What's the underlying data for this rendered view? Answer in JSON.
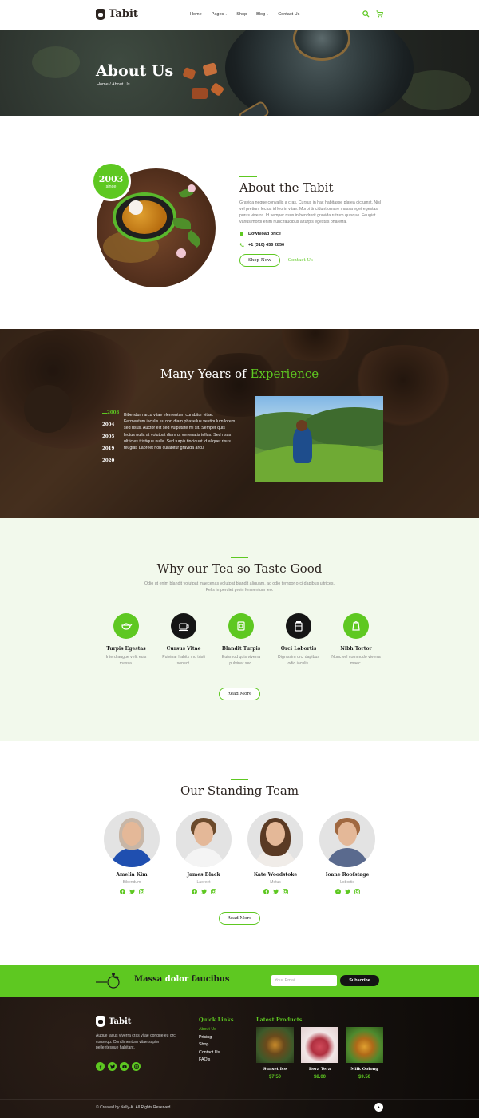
{
  "header": {
    "brand": "Tabit",
    "nav": [
      {
        "label": "Home",
        "has_dropdown": false
      },
      {
        "label": "Pages",
        "has_dropdown": true
      },
      {
        "label": "Shop",
        "has_dropdown": false
      },
      {
        "label": "Blog",
        "has_dropdown": true
      },
      {
        "label": "Contact Us",
        "has_dropdown": false
      }
    ],
    "cart_count": "0"
  },
  "hero": {
    "title": "About Us",
    "breadcrumb": "Home / About Us"
  },
  "about": {
    "badge_year": "2003",
    "badge_since": "since",
    "title": "About the Tabit",
    "text": "Gravida neque convallis a cras. Cursus in hac habitasse platea dictumst. Nisl vel pretium lectus id leo in vitae. Morbi tincidunt ornare massa eget egestas purus viverra. Id semper risus in hendrerit gravida rutrum quisque. Feugiat varius morbi enim nunc faucibus a turpis egestas pharetra.",
    "download_label": "Download price",
    "phone": "+1 (310) 456 2856",
    "shop_button": "Shop Now",
    "contact_link": "Contact Us"
  },
  "experience": {
    "title_prefix": "Many Years of ",
    "title_highlight": "Experience",
    "years": [
      "2003",
      "2004",
      "2005",
      "2019",
      "2020"
    ],
    "active_year_index": 0,
    "text": "Bibendum arcu vitae elementum curabitur vitae. Fermentum iaculis eu non diam phasellus vestibulum lorem sed risus. Auctor elit sed vulputate mi sit. Semper quis lectus nulla at volutpat diam ut venenatis tellus. Sed risus ultricies tristique nulla. Sed turpis tincidunt id aliquet risus feugiat. Laoreet non curabitur gravida arcu."
  },
  "why": {
    "title": "Why our Tea so Taste Good",
    "subtitle": "Odio ut enim blandit volutpat maecenas volutpat blandit aliquam, ac odio tempor orci dapibus ultrices. Felis imperdiet proin fermentum leo.",
    "features": [
      {
        "icon": "teapot-icon",
        "title": "Turpis Egestas",
        "desc": "Interd augue velit euis massa.",
        "style": "green"
      },
      {
        "icon": "teacup-icon",
        "title": "Cursus Vitae",
        "desc": "Pulvinar habitx mo tristi senect.",
        "style": "dark"
      },
      {
        "icon": "tea-box-icon",
        "title": "Blandit Turpis",
        "desc": "Euismod quis viverra pulvinar sed.",
        "style": "green"
      },
      {
        "icon": "tea-jar-icon",
        "title": "Orci Lobortis",
        "desc": "Dignissim orci dapibus odio iaculis.",
        "style": "dark"
      },
      {
        "icon": "tea-pack-icon",
        "title": "Nibh Tortor",
        "desc": "Nunc vel commodo viverra maec.",
        "style": "green"
      }
    ],
    "read_more": "Read More"
  },
  "team": {
    "title": "Our Standing Team",
    "members": [
      {
        "name": "Amelia Kim",
        "role": "Bibendum",
        "hair": "#c8b6a6",
        "shirt": "#1f4fb0"
      },
      {
        "name": "James Black",
        "role": "Laoreet",
        "hair": "#6b4a2c",
        "shirt": "#f4f4f4"
      },
      {
        "name": "Kate Woodstoke",
        "role": "Metus",
        "hair": "#5a3a24",
        "shirt": "#f0ece8"
      },
      {
        "name": "Ioane Roofstage",
        "role": "Lobortis",
        "hair": "#a06840",
        "shirt": "#5a6a8e"
      }
    ],
    "read_more": "Read More"
  },
  "newsletter": {
    "title_a": "Massa ",
    "title_b": "dolor",
    "title_c": " faucibus",
    "email_placeholder": "Your Email",
    "subscribe": "Subscribe"
  },
  "footer": {
    "brand": "Tabit",
    "desc": "Augue lacus viverra cras vitae congue eu orci consequ. Condimentum vitae sapien pellentesque habitant.",
    "quick_links_title": "Quick Links",
    "quick_links": [
      "About Us",
      "Pricing",
      "Shop",
      "Contact Us",
      "FAQ's"
    ],
    "active_link_index": 0,
    "products_title": "Latest Products",
    "products": [
      {
        "name": "Sunset Ice",
        "price": "$7.50"
      },
      {
        "name": "Bera Tera",
        "price": "$8.00"
      },
      {
        "name": "Milk Oolong",
        "price": "$9.50"
      }
    ],
    "copyright": "© Created by Nelly-K. All Rights Reserved"
  },
  "colors": {
    "accent": "#5ec821",
    "dark": "#2c2420"
  }
}
